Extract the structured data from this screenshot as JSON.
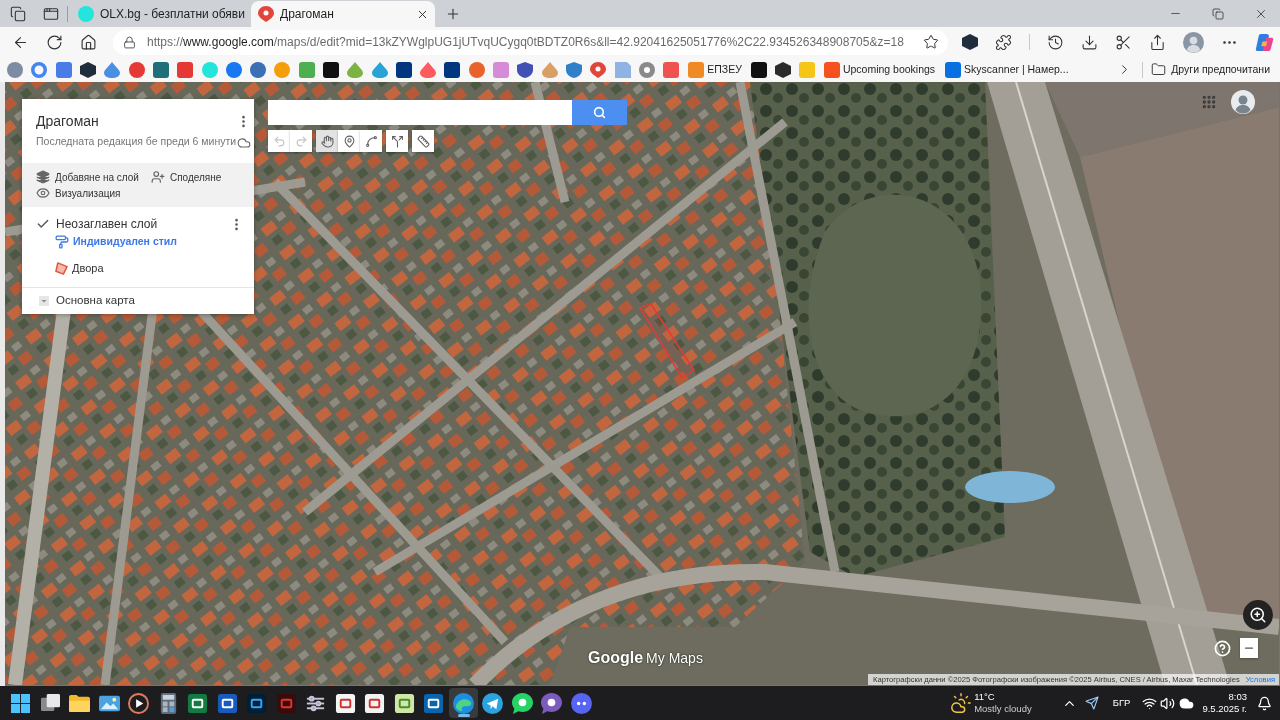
{
  "browser": {
    "tabs": [
      {
        "title": "OLX.bg - безплатни обяви",
        "selected": false
      },
      {
        "title": "Драгоман",
        "selected": true
      }
    ],
    "address_bar": {
      "scheme": "https://",
      "domain": "www.google.com",
      "path": "/maps/d/edit?mid=13kZYWglpUG1jUTvqUCygq0tBDTZ0R6s&ll=42.92041625051776%2C22.934526348908705&z=18"
    },
    "bookmarks": [
      "ЕПЗЕУ",
      "Upcoming bookings",
      "Skyscanner | Намер..."
    ],
    "other_bookmarks": "Други предпочитани"
  },
  "map_panel": {
    "title": "Драгоман",
    "subtitle": "Последната редакция бе преди 6 минути",
    "actions": [
      "Добавяне на слой",
      "Споделяне",
      "Визуализация"
    ],
    "layers": [
      {
        "name": "Неозаглавен слой",
        "checked": true,
        "style": "Индивидуален стил",
        "features": [
          "Двора"
        ]
      }
    ],
    "base_map": "Основна карта"
  },
  "map_toolbar": {
    "tools": [
      {
        "selected": false,
        "disabled": true
      },
      {
        "selected": false,
        "disabled": true
      },
      {
        "selected": true,
        "disabled": false
      },
      {
        "selected": false,
        "disabled": false
      },
      {
        "selected": false,
        "disabled": false
      },
      {
        "selected": false,
        "disabled": false
      },
      {
        "selected": false,
        "disabled": false
      }
    ]
  },
  "map_footer": {
    "logo_brand": "Google",
    "logo_product": "My Maps",
    "attribution": "Картографски данни ©2025 Фотографски изображения ©2025 Airbus, CNES / Airbus, Maxar Technologies",
    "terms_link": "Условия"
  },
  "taskbar": {
    "apps": [
      {
        "selected": false
      },
      {
        "selected": false
      },
      {
        "selected": false
      },
      {
        "selected": false
      },
      {
        "selected": false
      },
      {
        "selected": false
      },
      {
        "selected": false
      },
      {
        "selected": false
      },
      {
        "selected": false
      },
      {
        "selected": false
      },
      {
        "selected": false
      },
      {
        "selected": false
      },
      {
        "selected": false
      },
      {
        "selected": true
      },
      {
        "selected": false
      },
      {
        "selected": false
      },
      {
        "selected": false
      },
      {
        "selected": false
      }
    ],
    "weather": {
      "temperature": "11°C",
      "condition": "Mostly cloudy"
    },
    "language": "БГР",
    "time": "8:03",
    "date": "9.5.2025 г."
  }
}
